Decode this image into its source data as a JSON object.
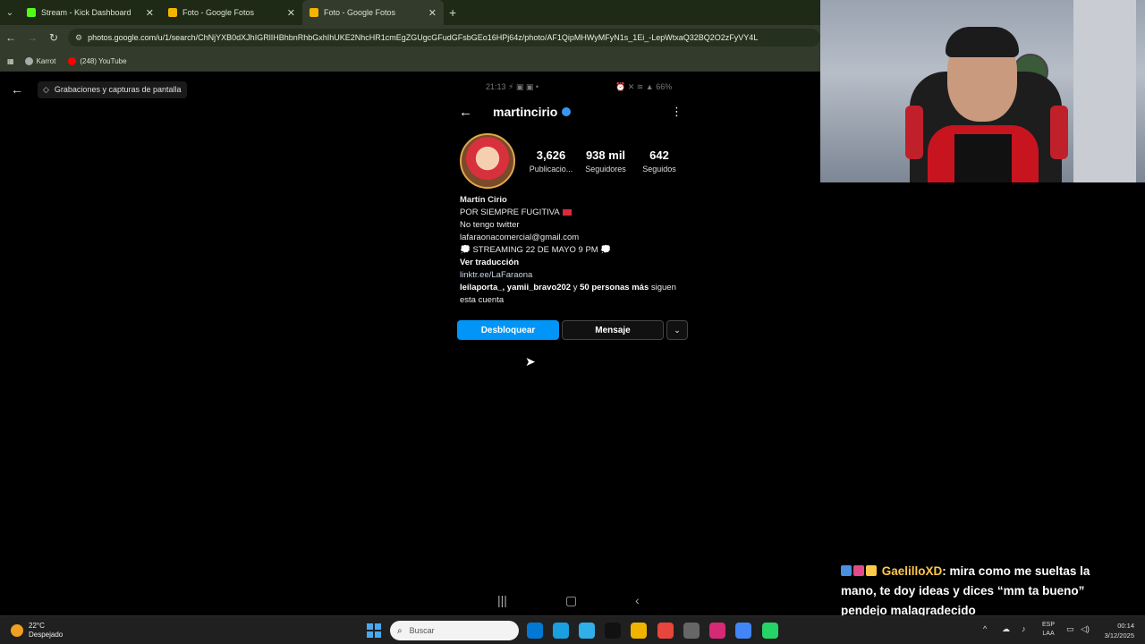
{
  "browser": {
    "tabs": [
      {
        "title": "Stream - Kick Dashboard",
        "favicon_color": "#53fc18",
        "active": false
      },
      {
        "title": "Foto - Google Fotos",
        "favicon_color": "#f4b400",
        "active": false
      },
      {
        "title": "Foto - Google Fotos",
        "favicon_color": "#f4b400",
        "active": true
      }
    ],
    "new_tab": "+",
    "url": "photos.google.com/u/1/search/ChNjYXB0dXJhIGRlIHBhbnRhbGxhIhUKE2NhcHR1cmEgZGUgcGFudGFsbGEo16HPj64z/photo/AF1QipMHWyMFyN1s_1Ei_-LepWtxaQ32BQ2O2zFyVY4L",
    "bookmarks": [
      {
        "label": "Karrot",
        "icon_color": "#aaaaaa"
      },
      {
        "label": "(248) YouTube",
        "icon_color": "#ff0000"
      }
    ]
  },
  "viewer": {
    "album_label": "Grabaciones y capturas de pantalla"
  },
  "phone": {
    "status_time": "21:13",
    "status_icons": "⚡ ▣ ▣ •",
    "battery": "66%",
    "status_right_icons": "⏰ ✕ ≋ ▲"
  },
  "profile": {
    "username": "martincirio",
    "stats": [
      {
        "value": "3,626",
        "label": "Publicacio..."
      },
      {
        "value": "938 mil",
        "label": "Seguidores"
      },
      {
        "value": "642",
        "label": "Seguidos"
      }
    ],
    "bio": {
      "name": "Martín Cirio",
      "line1": "POR SIEMPRE FUGITIVA",
      "line2": "No tengo twitter",
      "line3": "lafaraonacomercial@gmail.com",
      "line4": "💭 STREAMING 22 DE MAYO 9 PM 💭",
      "translate": "Ver traducción",
      "link": "linktr.ee/LaFaraona",
      "followed_by_bold": "leilaporta_, yamii_bravo202",
      "followed_by_mid": " y ",
      "followed_by_bold2": "50 personas más",
      "followed_by_rest": " siguen esta cuenta"
    },
    "buttons": {
      "unblock": "Desbloquear",
      "message": "Mensaje"
    }
  },
  "chat": {
    "username": "GaelilloXD",
    "message": ": mira como me sueltas la mano, te doy ideas y dices “mm ta bueno” pendejo malagradecido",
    "badge_colors": [
      "#4a90e2",
      "#e24a8a",
      "#ffc94a"
    ]
  },
  "taskbar": {
    "temperature": "22°C",
    "weather": "Despejado",
    "search_placeholder": "Buscar",
    "lang_top": "ESP",
    "lang_bottom": "LAA",
    "time": "00:14",
    "date": "3/12/2025",
    "app_colors": [
      "#0078d4",
      "#1a9fe0",
      "#30b0e8",
      "#111111",
      "#f0b400",
      "#e8453c",
      "#666666",
      "#d62976",
      "#4285f4",
      "#25d366"
    ]
  }
}
